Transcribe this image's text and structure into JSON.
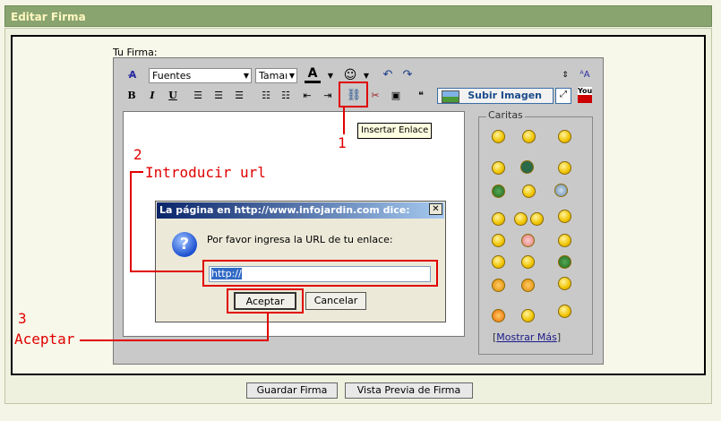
{
  "header": {
    "title": "Editar Firma"
  },
  "form": {
    "label": "Tu Firma:"
  },
  "toolbar": {
    "font_select": "Fuentes",
    "size_select": "Tamaı",
    "font_color": "A",
    "bold": "B",
    "italic": "I",
    "underline": "U",
    "upload_image": "Subir Imagen",
    "youtube": "You"
  },
  "tooltip": {
    "text": "Insertar Enlace"
  },
  "caritas": {
    "legend": "Caritas",
    "more_link": "Mostrar Más",
    "bracket_open": "[",
    "bracket_close": "]"
  },
  "dialog": {
    "title": "La página en http://www.infojardin.com dice:",
    "close": "✕",
    "question": "?",
    "message": "Por favor ingresa la URL de tu enlace:",
    "input_value": "http://",
    "ok": "Aceptar",
    "cancel": "Cancelar"
  },
  "annotations": {
    "step1": "1",
    "step2_num": "2",
    "step2_text": "Introducir url",
    "step3_num": "3",
    "step3_text": "Aceptar"
  },
  "footer": {
    "save": "Guardar Firma",
    "preview": "Vista Previa de Firma"
  }
}
